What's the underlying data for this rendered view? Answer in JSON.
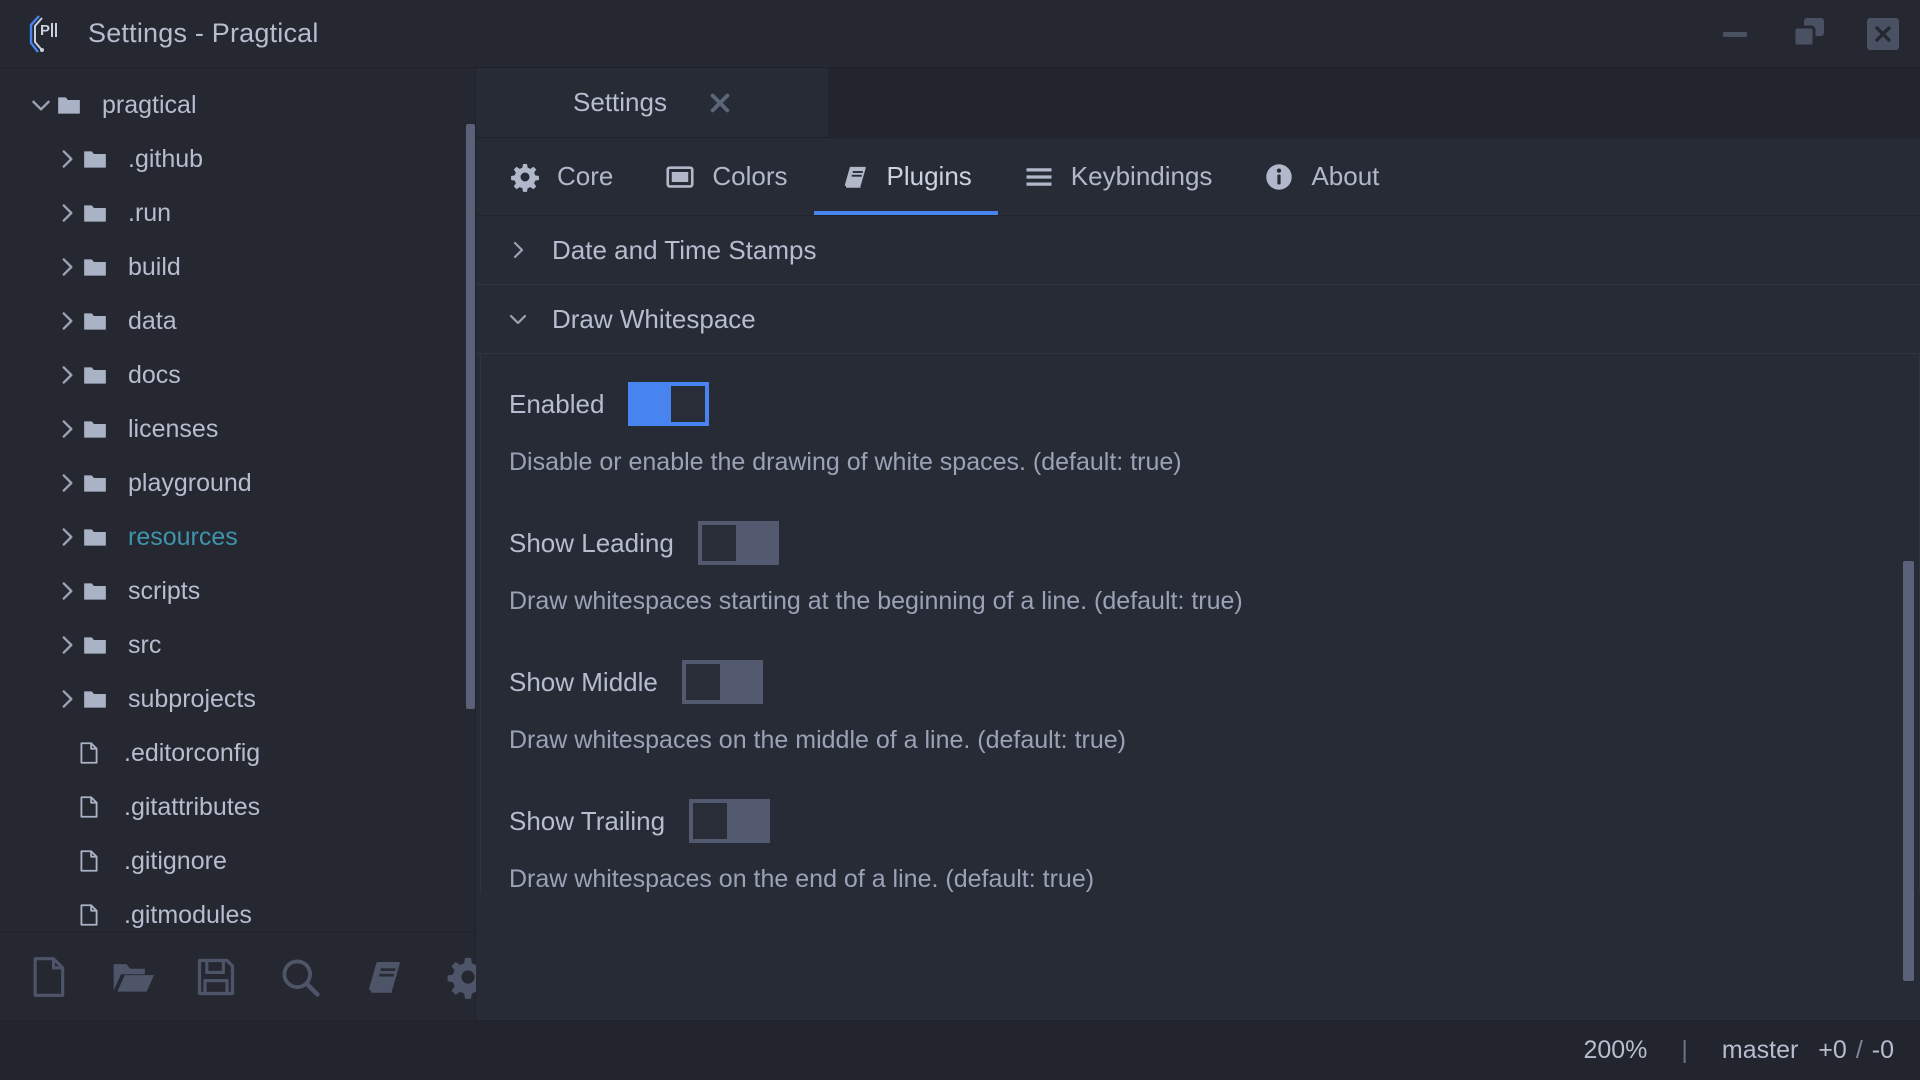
{
  "window": {
    "title": "Settings - Pragtical",
    "logo_icon": "pragtical-logo-icon",
    "controls": [
      {
        "name": "minimize",
        "icon": "minimize-icon"
      },
      {
        "name": "restore",
        "icon": "restore-icon"
      },
      {
        "name": "close",
        "icon": "close-icon"
      }
    ]
  },
  "sidebar": {
    "tree": [
      {
        "label": "pragtical",
        "type": "folder-open",
        "depth": 0,
        "expanded": true,
        "accent": false
      },
      {
        "label": ".github",
        "type": "folder",
        "depth": 1,
        "expanded": false,
        "accent": false
      },
      {
        "label": ".run",
        "type": "folder",
        "depth": 1,
        "expanded": false,
        "accent": false
      },
      {
        "label": "build",
        "type": "folder",
        "depth": 1,
        "expanded": false,
        "accent": false
      },
      {
        "label": "data",
        "type": "folder",
        "depth": 1,
        "expanded": false,
        "accent": false
      },
      {
        "label": "docs",
        "type": "folder",
        "depth": 1,
        "expanded": false,
        "accent": false
      },
      {
        "label": "licenses",
        "type": "folder",
        "depth": 1,
        "expanded": false,
        "accent": false
      },
      {
        "label": "playground",
        "type": "folder",
        "depth": 1,
        "expanded": false,
        "accent": false
      },
      {
        "label": "resources",
        "type": "folder",
        "depth": 1,
        "expanded": false,
        "accent": true
      },
      {
        "label": "scripts",
        "type": "folder",
        "depth": 1,
        "expanded": false,
        "accent": false
      },
      {
        "label": "src",
        "type": "folder",
        "depth": 1,
        "expanded": false,
        "accent": false
      },
      {
        "label": "subprojects",
        "type": "folder",
        "depth": 1,
        "expanded": false,
        "accent": false
      },
      {
        "label": ".editorconfig",
        "type": "file",
        "depth": 1,
        "expanded": false,
        "accent": false
      },
      {
        "label": ".gitattributes",
        "type": "file",
        "depth": 1,
        "expanded": false,
        "accent": false
      },
      {
        "label": ".gitignore",
        "type": "file",
        "depth": 1,
        "expanded": false,
        "accent": false
      },
      {
        "label": ".gitmodules",
        "type": "file",
        "depth": 1,
        "expanded": false,
        "accent": false
      }
    ],
    "toolbar": [
      {
        "name": "new-file-button",
        "icon": "new-file-icon"
      },
      {
        "name": "open-folder-button",
        "icon": "open-folder-icon"
      },
      {
        "name": "save-button",
        "icon": "save-floppy-icon"
      },
      {
        "name": "find-button",
        "icon": "search-icon"
      },
      {
        "name": "plugins-button",
        "icon": "book-icon"
      },
      {
        "name": "settings-button",
        "icon": "gear-icon"
      }
    ]
  },
  "doc_tabs": [
    {
      "label": "Settings",
      "active": true,
      "close_icon": "close-icon"
    }
  ],
  "section_tabs": [
    {
      "label": "Core",
      "icon": "gear-icon",
      "active": false
    },
    {
      "label": "Colors",
      "icon": "window-icon",
      "active": false
    },
    {
      "label": "Plugins",
      "icon": "book-icon",
      "active": true
    },
    {
      "label": "Keybindings",
      "icon": "hamburger-icon",
      "active": false
    },
    {
      "label": "About",
      "icon": "info-icon",
      "active": false
    }
  ],
  "settings": {
    "groups": [
      {
        "title": "Date and Time Stamps",
        "expanded": false,
        "options": []
      },
      {
        "title": "Draw Whitespace",
        "expanded": true,
        "options": [
          {
            "label": "Enabled",
            "value": true,
            "description": "Disable or enable the drawing of white spaces. (default: true)"
          },
          {
            "label": "Show Leading",
            "value": false,
            "description": "Draw whitespaces starting at the beginning of a line. (default: true)"
          },
          {
            "label": "Show Middle",
            "value": false,
            "description": "Draw whitespaces on the middle of a line. (default: true)"
          },
          {
            "label": "Show Trailing",
            "value": false,
            "description": "Draw whitespaces on the end of a line. (default: true)"
          }
        ]
      }
    ]
  },
  "statusbar": {
    "zoom": "200%",
    "separator": "|",
    "branch": "master",
    "added": "+0",
    "slash": "/",
    "removed": "-0"
  },
  "colors": {
    "accent_blue": "#4884f0",
    "folder_accent_teal": "#3f93ab",
    "toggle_off": "#535a70",
    "text": "#b6bdce",
    "bg": "#272b35"
  }
}
